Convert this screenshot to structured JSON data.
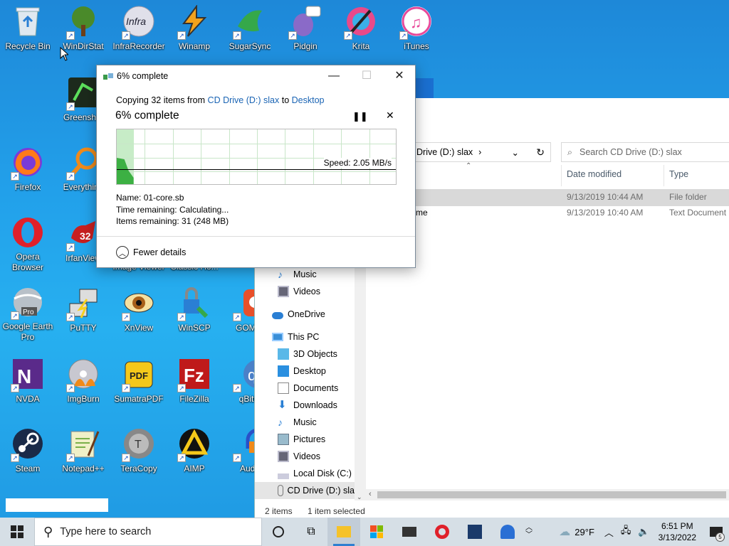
{
  "desktop_icons": [
    {
      "label": "Recycle Bin",
      "icon": "recycle-bin-icon"
    },
    {
      "label": "WinDirStat",
      "icon": "windirstat-icon"
    },
    {
      "label": "InfraRecorder",
      "icon": "infrarecorder-icon"
    },
    {
      "label": "Winamp",
      "icon": "winamp-icon"
    },
    {
      "label": "SugarSync",
      "icon": "sugarsync-icon"
    },
    {
      "label": "Pidgin",
      "icon": "pidgin-icon"
    },
    {
      "label": "Krita",
      "icon": "krita-icon"
    },
    {
      "label": "iTunes",
      "icon": "itunes-icon"
    },
    {
      "label": "Greenshot",
      "icon": "greenshot-icon"
    },
    {
      "label": "Firefox",
      "icon": "firefox-icon"
    },
    {
      "label": "Everything",
      "icon": "everything-icon"
    },
    {
      "label": "Opera Browser",
      "icon": "opera-icon"
    },
    {
      "label": "IrfanView",
      "icon": "irfanview-icon"
    },
    {
      "label": "Image Viewer",
      "icon": "image-viewer-icon"
    },
    {
      "label": "Classic Ho...",
      "icon": "classic-shell-icon"
    },
    {
      "label": "Google Earth Pro",
      "icon": "google-earth-icon"
    },
    {
      "label": "PuTTY",
      "icon": "putty-icon"
    },
    {
      "label": "XnView",
      "icon": "xnview-icon"
    },
    {
      "label": "WinSCP",
      "icon": "winscp-icon"
    },
    {
      "label": "GOM P",
      "icon": "gom-player-icon"
    },
    {
      "label": "NVDA",
      "icon": "nvda-icon"
    },
    {
      "label": "ImgBurn",
      "icon": "imgburn-icon"
    },
    {
      "label": "SumatraPDF",
      "icon": "sumatrapdf-icon"
    },
    {
      "label": "FileZilla",
      "icon": "filezilla-icon"
    },
    {
      "label": "qBitto",
      "icon": "qbittorrent-icon"
    },
    {
      "label": "Steam",
      "icon": "steam-icon"
    },
    {
      "label": "Notepad++",
      "icon": "notepadpp-icon"
    },
    {
      "label": "TeraCopy",
      "icon": "teracopy-icon"
    },
    {
      "label": "AIMP",
      "icon": "aimp-icon"
    },
    {
      "label": "Auda",
      "icon": "audacity-icon"
    }
  ],
  "copy_dialog": {
    "title": "6% complete",
    "copying_prefix": "Copying 32 items from",
    "source": "CD Drive (D:) slax",
    "to_word": "to",
    "destination": "Desktop",
    "heading": "6% complete",
    "progress": 0.06,
    "speed": "Speed: 2.05 MB/s",
    "name_label": "Name:",
    "name_value": "01-core.sb",
    "time_label": "Time remaining:",
    "time_value": "Calculating...",
    "items_label": "Items remaining:",
    "items_value": "31 (248 MB)",
    "fewer_details": "Fewer details",
    "pause_icon": "pause-icon",
    "close_icon": "close-icon"
  },
  "explorer": {
    "address_crumb": "Drive (D:) slax",
    "search_placeholder": "Search CD Drive (D:) slax",
    "columns": {
      "date": "Date modified",
      "type": "Type"
    },
    "rows": [
      {
        "name": "",
        "date": "9/13/2019 10:44 AM",
        "type": "File folder"
      },
      {
        "name": "me",
        "date": "9/13/2019 10:40 AM",
        "type": "Text Document"
      }
    ],
    "nav": [
      {
        "label": "Music",
        "icon": "music-icon"
      },
      {
        "label": "Videos",
        "icon": "videos-icon"
      },
      {
        "label": "OneDrive",
        "icon": "onedrive-icon"
      },
      {
        "label": "This PC",
        "icon": "this-pc-icon"
      },
      {
        "label": "3D Objects",
        "icon": "3d-objects-icon"
      },
      {
        "label": "Desktop",
        "icon": "desktop-folder-icon"
      },
      {
        "label": "Documents",
        "icon": "documents-icon"
      },
      {
        "label": "Downloads",
        "icon": "downloads-icon"
      },
      {
        "label": "Music",
        "icon": "music-icon"
      },
      {
        "label": "Pictures",
        "icon": "pictures-icon"
      },
      {
        "label": "Videos",
        "icon": "videos-icon"
      },
      {
        "label": "Local Disk (C:)",
        "icon": "local-disk-icon"
      },
      {
        "label": "CD Drive (D:) sla",
        "icon": "cd-drive-icon"
      }
    ],
    "status_items": "2 items",
    "status_selected": "1 item selected"
  },
  "taskbar": {
    "search_placeholder": "Type here to search",
    "temperature": "29°F",
    "time": "6:51 PM",
    "date": "3/13/2022",
    "notifications": "5"
  },
  "colors": {
    "accent": "#1a64b4",
    "progress_fill": "#3cb043",
    "desktop": "#22a0ea"
  }
}
